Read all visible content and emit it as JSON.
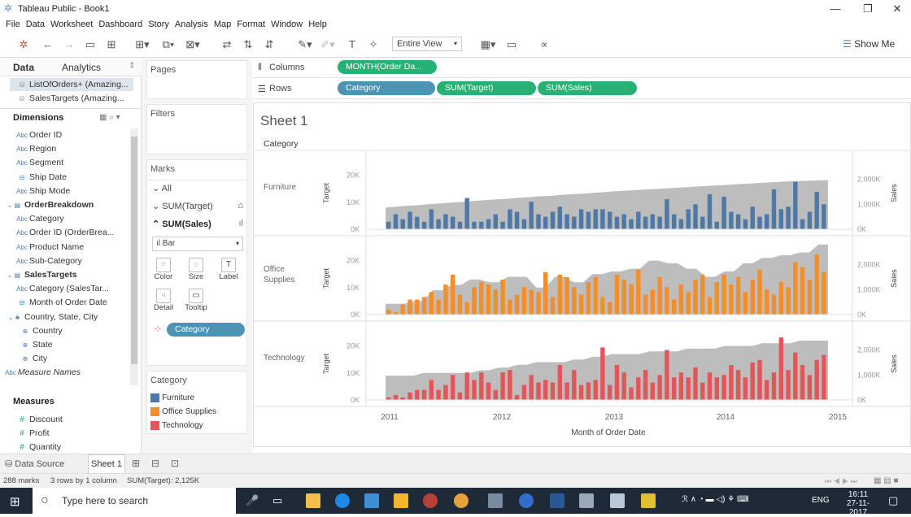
{
  "window": {
    "title": "Tableau Public - Book1",
    "minimize": "—",
    "restore": "❐",
    "close": "✕"
  },
  "menu": [
    "File",
    "Data",
    "Worksheet",
    "Dashboard",
    "Story",
    "Analysis",
    "Map",
    "Format",
    "Window",
    "Help"
  ],
  "toolbar": {
    "view_select": "Entire View",
    "show_me": "Show Me"
  },
  "left": {
    "tab_data": "Data",
    "tab_analytics": "Analytics",
    "sources": [
      "ListOfOrders+ (Amazing...",
      "SalesTargets (Amazing..."
    ],
    "dimensions_label": "Dimensions",
    "dim_items": [
      {
        "type": "Abc",
        "label": "Order ID",
        "indent": 1
      },
      {
        "type": "Abc",
        "label": "Region",
        "indent": 1
      },
      {
        "type": "Abc",
        "label": "Segment",
        "indent": 1
      },
      {
        "type": "date",
        "label": "Ship Date",
        "indent": 1
      },
      {
        "type": "Abc",
        "label": "Ship Mode",
        "indent": 1
      },
      {
        "type": "folder",
        "label": "OrderBreakdown",
        "indent": 0
      },
      {
        "type": "Abc",
        "label": "Category",
        "indent": 1
      },
      {
        "type": "Abc",
        "label": "Order ID (OrderBrea...",
        "indent": 1
      },
      {
        "type": "Abc",
        "label": "Product Name",
        "indent": 1
      },
      {
        "type": "Abc",
        "label": "Sub-Category",
        "indent": 1
      },
      {
        "type": "folder",
        "label": "SalesTargets",
        "indent": 0
      },
      {
        "type": "Abc",
        "label": "Category (SalesTar...",
        "indent": 1
      },
      {
        "type": "date",
        "label": "Month of Order Date",
        "indent": 1
      },
      {
        "type": "hier",
        "label": "Country, State, City",
        "indent": 0
      },
      {
        "type": "geo",
        "label": "Country",
        "indent": 2
      },
      {
        "type": "geo",
        "label": "State",
        "indent": 2
      },
      {
        "type": "geo",
        "label": "City",
        "indent": 2
      },
      {
        "type": "Abc",
        "label": "Measure Names",
        "indent": 0
      }
    ],
    "measures_label": "Measures",
    "measure_items": [
      "Discount",
      "Profit",
      "Quantity"
    ]
  },
  "mid": {
    "pages": "Pages",
    "filters": "Filters",
    "marks": "Marks",
    "all": "All",
    "sum_target": "SUM(Target)",
    "sum_sales": "SUM(Sales)",
    "marktype": "Bar",
    "buttons": [
      "Color",
      "Size",
      "Label",
      "Detail",
      "Tooltip"
    ],
    "category_pill": "Category",
    "legend_title": "Category",
    "legend": [
      {
        "label": "Furniture",
        "color": "#4e79a7"
      },
      {
        "label": "Office Supplies",
        "color": "#f28e2b"
      },
      {
        "label": "Technology",
        "color": "#e15759"
      }
    ]
  },
  "shelves": {
    "columns_label": "Columns",
    "rows_label": "Rows",
    "col_pill": "MONTH(Order Da...",
    "row_pills": [
      "Category",
      "SUM(Target)",
      "SUM(Sales)"
    ]
  },
  "sheet": {
    "title": "Sheet 1",
    "header": "Category",
    "xaxis_label": "Month of Order Date"
  },
  "chart_data": {
    "type": "bar",
    "x_ticks": [
      "2011",
      "2012",
      "2013",
      "2014",
      "2015"
    ],
    "xlabel": "Month of Order Date",
    "ylabel_left": "Target",
    "ylabel_right": "Sales",
    "left_ticks": [
      "20K",
      "10K",
      "0K"
    ],
    "right_ticks": [
      "2,000K",
      "1,000K",
      "0K"
    ],
    "panes": [
      {
        "category": "Furniture",
        "label": "Furniture",
        "color": "#4e79a7",
        "target": [
          8,
          8.3,
          8.6,
          8.8,
          9.1,
          9.4,
          9.6,
          9.9,
          10.1,
          10.4,
          10.6,
          10.9,
          11.1,
          11.3,
          11.6,
          11.8,
          12.1,
          12.3,
          12.5,
          12.8,
          13,
          13.2,
          13.5,
          13.7,
          14,
          14.2,
          14.4,
          14.6,
          14.8,
          15,
          15.2,
          15.4,
          15.6,
          15.8,
          16,
          16.2,
          16.4,
          16.6,
          16.8,
          17,
          17.2,
          17.4,
          17.6,
          17.8,
          17.9,
          18,
          18.1,
          18.2
        ],
        "sales": [
          3,
          6,
          4,
          7,
          5,
          3,
          8,
          4,
          6,
          5,
          3,
          12.5,
          3,
          3,
          4,
          6,
          3,
          8,
          7,
          4,
          11,
          6,
          5,
          7,
          9,
          6,
          5,
          8,
          7,
          8,
          8,
          7,
          5,
          6,
          4,
          7,
          5,
          6,
          5,
          12,
          6,
          4,
          8,
          10,
          5,
          14,
          3,
          13,
          7,
          6,
          4,
          9,
          5,
          6,
          16,
          8,
          9,
          19,
          4,
          7,
          15,
          10
        ]
      },
      {
        "category": "Office Supplies",
        "label": "Office\nSupplies",
        "color": "#f28e2b",
        "target": [
          4,
          4,
          4,
          5,
          5,
          9,
          9,
          11,
          11,
          13,
          13,
          12,
          12,
          14,
          14,
          14,
          10,
          10,
          14,
          14,
          12,
          12,
          15,
          15,
          16,
          16,
          17,
          17,
          20,
          20,
          19,
          19,
          17,
          17,
          14,
          14,
          16,
          16,
          19,
          19,
          21,
          21,
          22,
          22,
          23,
          23,
          26,
          26
        ],
        "sales": [
          2,
          1,
          4,
          6,
          6,
          7,
          9,
          6,
          12,
          16,
          8,
          5,
          11,
          13,
          12,
          10,
          14,
          6,
          8,
          11,
          10,
          9,
          17,
          7,
          16,
          15,
          11,
          8,
          13,
          15,
          7,
          5,
          16,
          14,
          12,
          18,
          8,
          10,
          15,
          11,
          6,
          12,
          9,
          14,
          16,
          7,
          13,
          16,
          12,
          15,
          9,
          14,
          18,
          10,
          8,
          13,
          11,
          21,
          19,
          14,
          24,
          17
        ]
      },
      {
        "category": "Technology",
        "label": "Technology",
        "color": "#e15759",
        "target": [
          9,
          9,
          9,
          9,
          10,
          10,
          10,
          10,
          10,
          10,
          11,
          11,
          12,
          12,
          13,
          13,
          14,
          14,
          14,
          14,
          15,
          15,
          16,
          16,
          17,
          17,
          17,
          17,
          18,
          18,
          18,
          18,
          19,
          19,
          19,
          19,
          20,
          20,
          20,
          20,
          21,
          21,
          21,
          21,
          22,
          22,
          22,
          22
        ],
        "sales": [
          1,
          2,
          1,
          3,
          4,
          4,
          8,
          4,
          6,
          10,
          3,
          11,
          8,
          11,
          7,
          4,
          11,
          12,
          2,
          6,
          10,
          7,
          8,
          7,
          14,
          7,
          12,
          6,
          7,
          8,
          21,
          6,
          14,
          11,
          5,
          9,
          12,
          7,
          10,
          20,
          9,
          11,
          9,
          13,
          7,
          11,
          9,
          10,
          14,
          12,
          9,
          15,
          16,
          8,
          11,
          25,
          12,
          19,
          14,
          10,
          16,
          18
        ]
      }
    ],
    "legend": [
      "Furniture",
      "Office Supplies",
      "Technology"
    ]
  },
  "bottom": {
    "data_source": "Data Source",
    "sheet_tab": "Sheet 1"
  },
  "status": {
    "marks": "288 marks",
    "dims": "3 rows by 1 column",
    "sum": "SUM(Target): 2,125K"
  },
  "taskbar": {
    "search": "Type here to search",
    "lang": "ENG",
    "time": "16:11",
    "date": "27-11-2017"
  }
}
